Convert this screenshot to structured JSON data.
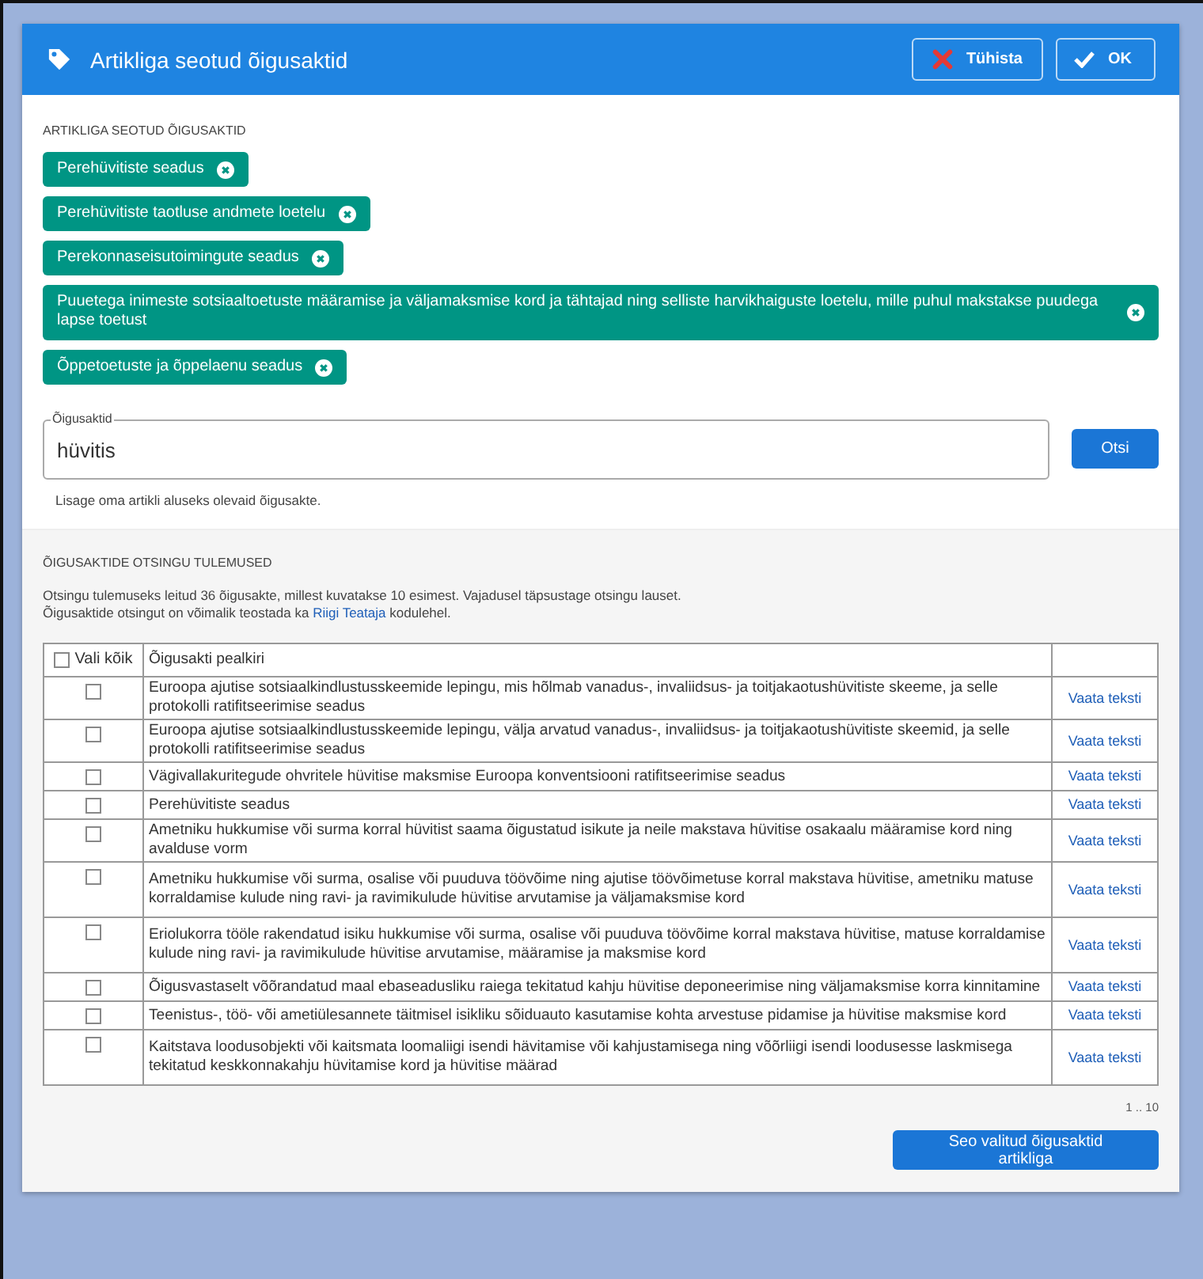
{
  "dialog": {
    "title": "Artikliga seotud õigusaktid",
    "buttons": [
      {
        "kind": "cancel",
        "label": "Tühista"
      },
      {
        "kind": "ok",
        "label": "OK"
      }
    ]
  },
  "linked": {
    "heading": "ARTIKLIGA SEOTUD ÕIGUSAKTID",
    "chips": [
      {
        "label": "Perehüvitiste seadus"
      },
      {
        "label": "Perehüvitiste taotluse andmete loetelu"
      },
      {
        "label": "Perekonnaseisutoimingute seadus"
      },
      {
        "label": "Puuetega inimeste sotsiaaltoetuste määramise ja väljamaksmise kord ja tähtajad ning selliste harvikhaiguste loetelu, mille puhul makstakse puudega lapse toetust"
      },
      {
        "label": "Õppetoetuste ja õppelaenu seadus"
      }
    ]
  },
  "search": {
    "label": "Õigusaktid",
    "value": "hüvitis",
    "button": "Otsi",
    "hint": "Lisage oma artikli aluseks olevaid õigusakte."
  },
  "results": {
    "heading": "ÕIGUSAKTIDE OTSINGU TULEMUSED",
    "info": "Otsingu tulemuseks leitud 36 õigusakte, millest kuvatakse 10 esimest. Vajadusel täpsustage otsingu lauset.",
    "info2": {
      "before": "Õigusaktide otsingut on võimalik teostada ka",
      "link": "Riigi Teataja",
      "after": "kodulehel."
    },
    "select_all": {
      "label": "Vali kõik",
      "checked": false
    },
    "title_column": "Õigusakti pealkiri",
    "rows": [
      {
        "checked": false,
        "title": "Euroopa ajutise sotsiaalkindlustusskeemide lepingu, mis hõlmab vanadus-, invaliidsus- ja toitjakaotushüvitiste skeeme, ja selle protokolli ratifitseerimise seadus",
        "link": "Vaata teksti"
      },
      {
        "checked": false,
        "title": "Euroopa ajutise sotsiaalkindlustusskeemide lepingu, välja arvatud vanadus-, invaliidsus- ja toitjakaotushüvitiste skeemid, ja selle protokolli ratifitseerimise seadus",
        "link": "Vaata teksti"
      },
      {
        "checked": false,
        "title": "Vägivallakuritegude ohvritele hüvitise maksmise Euroopa konventsiooni ratifitseerimise seadus",
        "link": "Vaata teksti"
      },
      {
        "checked": false,
        "title": "Perehüvitiste seadus",
        "link": "Vaata teksti"
      },
      {
        "checked": false,
        "title": "Ametniku hukkumise või surma korral hüvitist saama õigustatud isikute ja neile makstava hüvitise osakaalu määramise kord ning avalduse vorm",
        "link": "Vaata teksti"
      },
      {
        "checked": false,
        "title": "Ametniku hukkumise või surma, osalise või puuduva töövõime ning ajutise töövõimetuse korral makstava hüvitise, ametniku matuse korraldamise kulude ning ravi- ja ravimikulude hüvitise arvutamise ja väljamaksmise kord",
        "link": "Vaata teksti"
      },
      {
        "checked": false,
        "title": "Eriolukorra tööle rakendatud isiku hukkumise või surma, osalise või puuduva töövõime korral makstava hüvitise, matuse korraldamise kulude ning ravi- ja ravimikulude hüvitise arvutamise, määramise ja maksmise kord",
        "link": "Vaata teksti"
      },
      {
        "checked": false,
        "title": "Õigusvastaselt võõrandatud maal ebaseadusliku raiega tekitatud kahju hüvitise deponeerimise ning väljamaksmise korra kinnitamine",
        "link": "Vaata teksti"
      },
      {
        "checked": false,
        "title": "Teenistus-, töö- või ametiülesannete täitmisel isikliku sõiduauto kasutamise kohta arvestuse pidamise ja hüvitise maksmise kord",
        "link": "Vaata teksti"
      },
      {
        "checked": false,
        "title": "Kaitstava loodusobjekti või kaitsmata loomaliigi isendi hävitamise või kahjustamisega ning võõrliigi isendi loodusesse laskmisega tekitatud keskkonnakahju hüvitamise kord ja hüvitise määrad",
        "link": "Vaata teksti"
      }
    ],
    "pagination": "1 .. 10",
    "submit": "Seo valitud õigusaktid artikliga"
  }
}
